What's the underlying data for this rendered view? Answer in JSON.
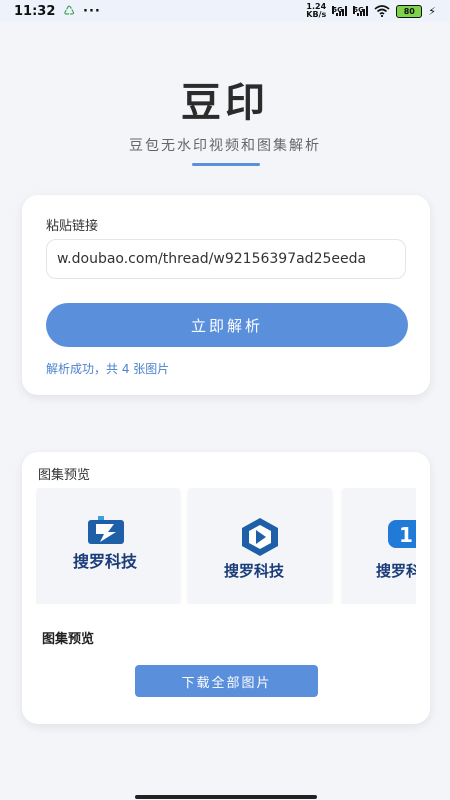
{
  "status_bar": {
    "time": "11:32",
    "recycle_icon": "♺",
    "dots": "···",
    "speed_value": "1.24",
    "speed_unit": "KB/s",
    "sig1_label": "5G",
    "sig2_label": "5G",
    "battery": "80",
    "wifi_icon": "wifi-icon",
    "bolt": "⚡"
  },
  "header": {
    "title": "豆印",
    "subtitle": "豆包无水印视频和图集解析"
  },
  "parse_card": {
    "label": "粘贴链接",
    "url_value": "w.doubao.com/thread/w92156397ad25eeda",
    "parse_button": "立即解析",
    "status": "解析成功，共 4 张图片"
  },
  "gallery": {
    "heading": "图集预览",
    "images": [
      {
        "text": "搜罗科技"
      },
      {
        "text": "搜罗科技"
      },
      {
        "text": "搜罗科技"
      }
    ],
    "subheading": "图集预览",
    "download_button": "下载全部图片"
  },
  "colors": {
    "accent": "#5a8fdc",
    "status_text": "#4a82cf",
    "background": "#f3f5f9"
  }
}
